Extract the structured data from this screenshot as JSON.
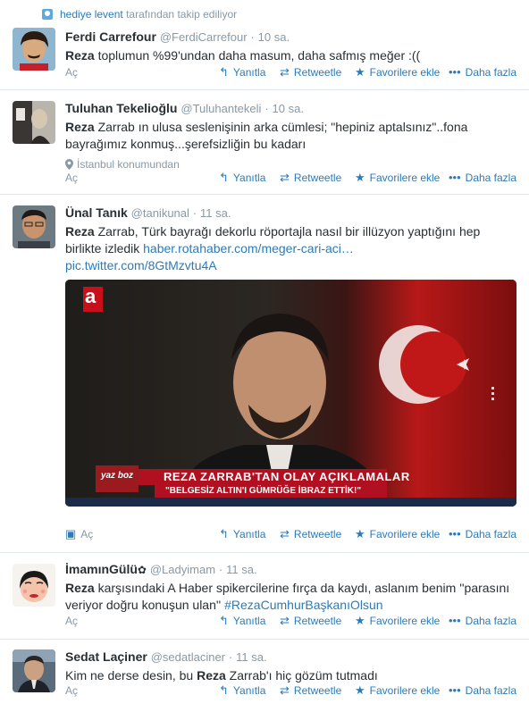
{
  "context": {
    "name": "hediye levent",
    "suffix": "tarafından takip ediliyor"
  },
  "actions": {
    "expand_left": "Aç",
    "reply": "Yanıtla",
    "retweet": "Retweetle",
    "favorite": "Favorilere ekle",
    "more": "Daha fazla"
  },
  "tweets": [
    {
      "fullname": "Ferdi Carrefour",
      "username": "@FerdiCarrefour",
      "time": "10 sa.",
      "text_bold": "Reza",
      "text": " toplumun %99'undan daha masum, daha safmış meğer :(("
    },
    {
      "fullname": "Tuluhan Tekelioğlu",
      "username": "@Tuluhantekeli",
      "time": "10 sa.",
      "text_bold": "Reza",
      "text": " Zarrab ın ulusa seslenişinin arka cümlesi; \"hepiniz aptalsınız\"..fona bayrağımız konmuş...şerefsizliğin bu kadarı",
      "location": "İstanbul konumundan"
    },
    {
      "fullname": "Ünal Tanık",
      "username": "@tanikunal",
      "time": "11 sa.",
      "text_bold": "Reza",
      "text": " Zarrab, Türk bayrağı dekorlu röportajla nasıl bir illüzyon yaptığını hep birlikte izledik ",
      "link1": "haber.rotahaber.com/meger-cari-aci…",
      "link2": "pic.twitter.com/8GtMzvtu4A",
      "media": {
        "channel": "a",
        "headline": "REZA ZARRAB'TAN OLAY AÇIKLAMALAR",
        "subline": "\"BELGESİZ ALTIN'I GÜMRÜĞE İBRAZ ETTİK!\"",
        "show_logo": "yaz boz"
      }
    },
    {
      "fullname": "İmamınGülü",
      "username": "@Ladyimam",
      "time": "11 sa.",
      "text_bold": "Reza",
      "text": " karşısındaki A Haber spikercilerine fırça da kaydı, aslanım benim ''parasını veriyor doğru konuşun ulan'' ",
      "hashtag": "#RezaCumhurBaşkanıOlsun"
    },
    {
      "fullname": "Sedat Laçiner",
      "username": "@sedatlaciner",
      "time": "11 sa.",
      "text_pre": "Kim ne derse desin, bu ",
      "text_bold": "Reza",
      "text": " Zarrab'ı hiç gözüm tutmadı"
    }
  ]
}
